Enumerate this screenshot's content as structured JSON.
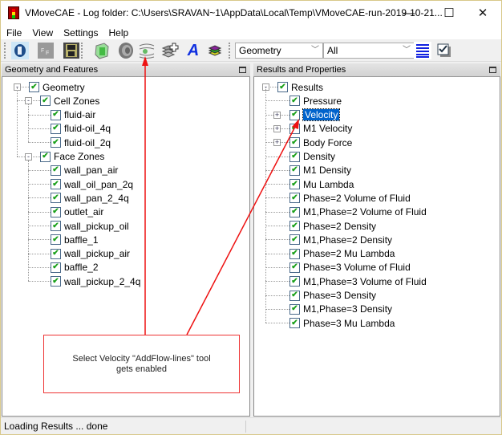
{
  "window": {
    "title": "VMoveCAE - Log folder: C:\\Users\\SRAVAN~1\\AppData\\Local\\Temp\\VMoveCAE-run-2019-10-21...",
    "minimize_label": "—",
    "maximize_label": "☐",
    "close_label": "✕"
  },
  "menu": [
    "File",
    "View",
    "Settings",
    "Help"
  ],
  "toolbar": {
    "icons": [
      "open-icon",
      "ff-icon",
      "save-icon",
      "cube-icon",
      "disk-icon",
      "add-flow-lines-icon",
      "add-layer-icon",
      "text-icon",
      "layers-icon",
      "list-icon",
      "checkbox-icon"
    ],
    "text_glyph": "A",
    "combo_left": "Geometry",
    "combo_right": "All"
  },
  "left_panel": {
    "title": "Geometry and Features",
    "root": "Geometry",
    "groups": [
      {
        "label": "Cell Zones",
        "items": [
          "fluid-air",
          "fluid-oil_4q",
          "fluid-oil_2q"
        ]
      },
      {
        "label": "Face Zones",
        "items": [
          "wall_pan_air",
          "wall_oil_pan_2q",
          "wall_pan_2_4q",
          "outlet_air",
          "wall_pickup_oil",
          "baffle_1",
          "wall_pickup_air",
          "baffle_2",
          "wall_pickup_2_4q"
        ]
      }
    ]
  },
  "right_panel": {
    "title": "Results and Properties",
    "root": "Results",
    "items": [
      {
        "label": "Pressure",
        "expandable": false,
        "selected": false
      },
      {
        "label": "Velocity",
        "expandable": true,
        "selected": true
      },
      {
        "label": "M1 Velocity",
        "expandable": true,
        "selected": false
      },
      {
        "label": "Body Force",
        "expandable": true,
        "selected": false
      },
      {
        "label": "Density",
        "expandable": false,
        "selected": false
      },
      {
        "label": "M1 Density",
        "expandable": false,
        "selected": false
      },
      {
        "label": "Mu Lambda",
        "expandable": false,
        "selected": false
      },
      {
        "label": "Phase=2 Volume of Fluid",
        "expandable": false,
        "selected": false
      },
      {
        "label": "M1,Phase=2 Volume of Fluid",
        "expandable": false,
        "selected": false
      },
      {
        "label": "Phase=2 Density",
        "expandable": false,
        "selected": false
      },
      {
        "label": "M1,Phase=2 Density",
        "expandable": false,
        "selected": false
      },
      {
        "label": "Phase=2 Mu Lambda",
        "expandable": false,
        "selected": false
      },
      {
        "label": "Phase=3 Volume of Fluid",
        "expandable": false,
        "selected": false
      },
      {
        "label": "M1,Phase=3 Volume of Fluid",
        "expandable": false,
        "selected": false
      },
      {
        "label": "Phase=3 Density",
        "expandable": false,
        "selected": false
      },
      {
        "label": "M1,Phase=3 Density",
        "expandable": false,
        "selected": false
      },
      {
        "label": "Phase=3 Mu Lambda",
        "expandable": false,
        "selected": false
      }
    ]
  },
  "annotation": {
    "line1": "Select Velocity \"AddFlow-lines\" tool",
    "line2": "gets enabled",
    "color": "#ee1111"
  },
  "status": "Loading Results ... done",
  "colors": {
    "selection": "#0063cc",
    "check": "#1aa01a"
  }
}
